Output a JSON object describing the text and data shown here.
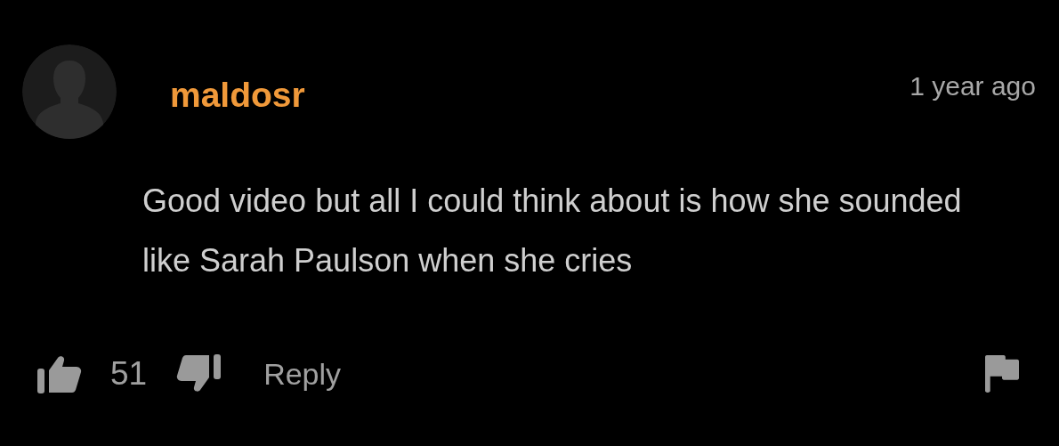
{
  "comment": {
    "username": "maldosr",
    "time": "1 year ago",
    "text": "Good video but all I could think about is how she sounded like Sarah Paulson when she cries",
    "likes": "51",
    "reply": "Reply"
  }
}
